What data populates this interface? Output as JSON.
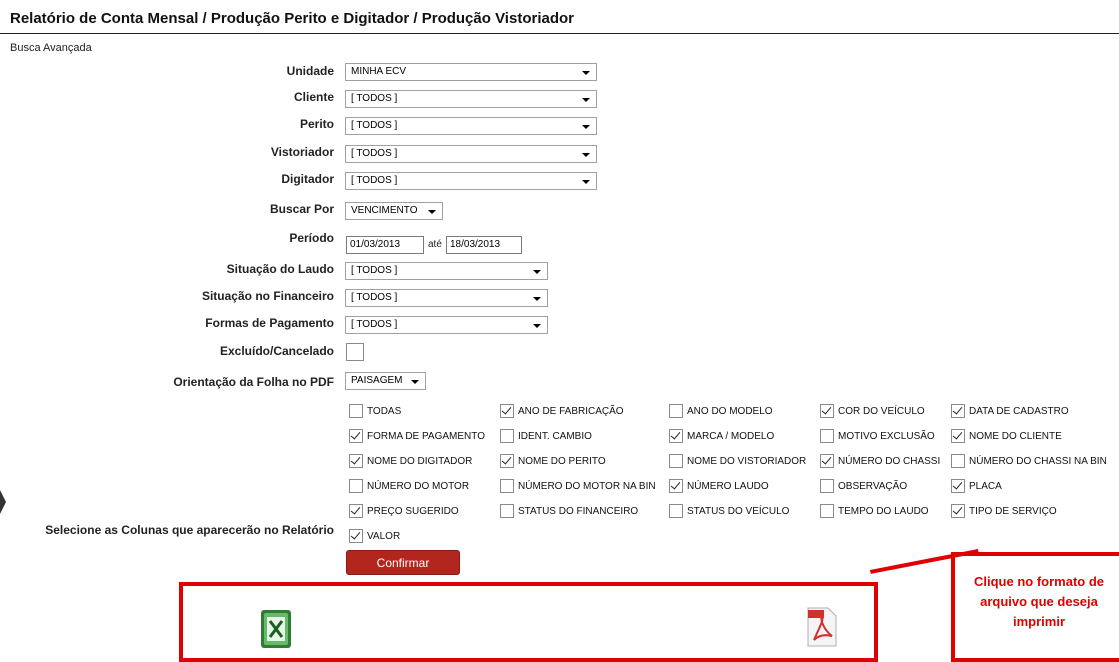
{
  "page_title": "Relatório de Conta Mensal / Produção Perito e Digitador / Produção Vistoriador",
  "subtitle": "Busca Avançada",
  "fields": {
    "unidade": {
      "label": "Unidade",
      "value": "MINHA ECV"
    },
    "cliente": {
      "label": "Cliente",
      "value": "[ TODOS ]"
    },
    "perito": {
      "label": "Perito",
      "value": "[ TODOS ]"
    },
    "vistoriador": {
      "label": "Vistoriador",
      "value": "[ TODOS ]"
    },
    "digitador": {
      "label": "Digitador",
      "value": "[ TODOS ]"
    },
    "buscar_por": {
      "label": "Buscar Por",
      "value": "VENCIMENTO"
    },
    "periodo": {
      "label": "Período",
      "start": "01/03/2013",
      "sep": "até",
      "end": "18/03/2013"
    },
    "situacao_laudo": {
      "label": "Situação do Laudo",
      "value": "[ TODOS ]"
    },
    "situacao_financeiro": {
      "label": "Situação no Financeiro",
      "value": "[ TODOS ]"
    },
    "formas_pagamento": {
      "label": "Formas de Pagamento",
      "value": "[ TODOS ]"
    },
    "excluido": {
      "label": "Excluído/Cancelado",
      "checked": false
    },
    "orientacao": {
      "label": "Orientação da Folha no PDF",
      "value": "PAISAGEM"
    }
  },
  "columns_label": "Selecione as Colunas que aparecerão no Relatório",
  "columns": [
    {
      "label": "TODAS",
      "checked": false
    },
    {
      "label": "ANO DE FABRICAÇÃO",
      "checked": true
    },
    {
      "label": "ANO DO MODELO",
      "checked": false
    },
    {
      "label": "COR DO VEÍCULO",
      "checked": true
    },
    {
      "label": "DATA DE CADASTRO",
      "checked": true
    },
    {
      "label": "FORMA DE PAGAMENTO",
      "checked": true
    },
    {
      "label": "IDENT. CAMBIO",
      "checked": false
    },
    {
      "label": "MARCA / MODELO",
      "checked": true
    },
    {
      "label": "MOTIVO EXCLUSÃO",
      "checked": false
    },
    {
      "label": "NOME DO CLIENTE",
      "checked": true
    },
    {
      "label": "NOME DO DIGITADOR",
      "checked": true
    },
    {
      "label": "NOME DO PERITO",
      "checked": true
    },
    {
      "label": "NOME DO VISTORIADOR",
      "checked": false
    },
    {
      "label": "NÚMERO DO CHASSI",
      "checked": true
    },
    {
      "label": "NÚMERO DO CHASSI NA BIN",
      "checked": false
    },
    {
      "label": "NÚMERO DO MOTOR",
      "checked": false
    },
    {
      "label": "NÚMERO DO MOTOR NA BIN",
      "checked": false
    },
    {
      "label": "NÚMERO LAUDO",
      "checked": true
    },
    {
      "label": "OBSERVAÇÃO",
      "checked": false
    },
    {
      "label": "PLACA",
      "checked": true
    },
    {
      "label": "PREÇO SUGERIDO",
      "checked": true
    },
    {
      "label": "STATUS DO FINANCEIRO",
      "checked": false
    },
    {
      "label": "STATUS DO VEÍCULO",
      "checked": false
    },
    {
      "label": "TEMPO DO LAUDO",
      "checked": false
    },
    {
      "label": "TIPO DE SERVIÇO",
      "checked": true
    },
    {
      "label": "VALOR",
      "checked": true
    }
  ],
  "confirm_label": "Confirmar",
  "callout_text": "Clique no formato de arquivo que deseja imprimir",
  "icons": {
    "excel": "excel-file-icon",
    "pdf": "pdf-file-icon"
  },
  "colors": {
    "accent": "#b3261e",
    "annotation": "#e00000"
  }
}
